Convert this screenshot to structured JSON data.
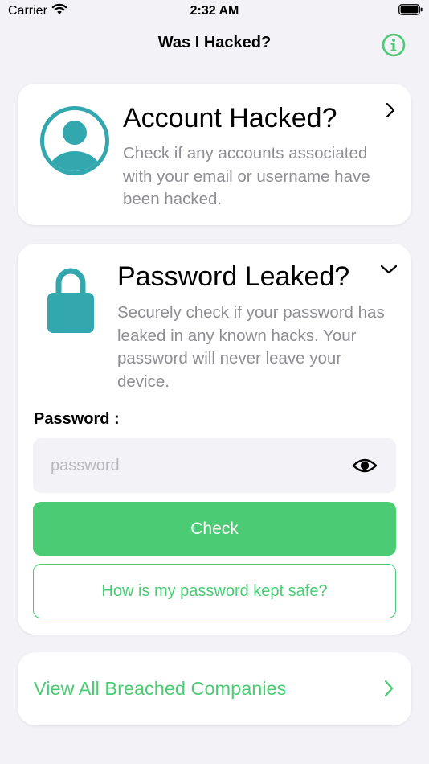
{
  "status_bar": {
    "carrier": "Carrier",
    "time": "2:32 AM"
  },
  "nav": {
    "title": "Was I Hacked?",
    "info_icon": "info-circle-icon"
  },
  "colors": {
    "accent": "#4bcb73",
    "teal": "#32a7ae",
    "secondary_text": "#8e8e93",
    "background": "#f2f2f7"
  },
  "account_card": {
    "title": "Account Hacked?",
    "description": "Check if any accounts associated with your email or username have been hacked.",
    "icon": "user-avatar-icon"
  },
  "password_card": {
    "title": "Password Leaked?",
    "description": "Securely check if your password has leaked in any known hacks. Your password will never leave your device.",
    "icon": "lock-icon",
    "field_label": "Password :",
    "field_value": "",
    "field_placeholder": "password",
    "check_label": "Check",
    "safe_label": "How is my password kept safe?"
  },
  "breached_card": {
    "label": "View All Breached Companies"
  }
}
